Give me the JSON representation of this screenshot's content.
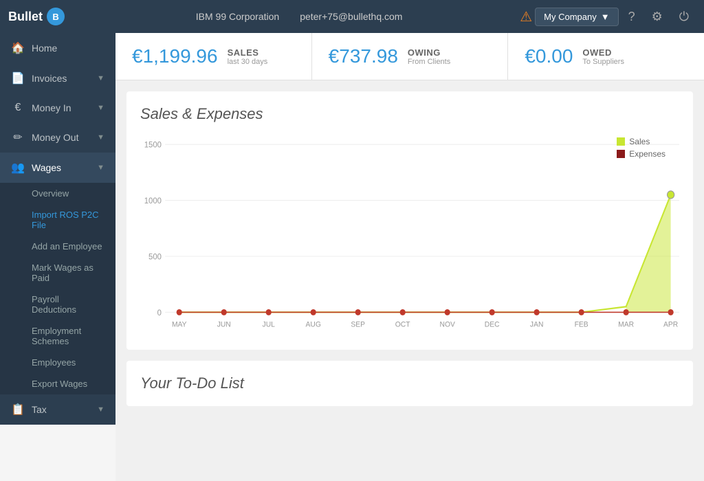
{
  "topnav": {
    "logo_text": "Bullet",
    "logo_badge": "B",
    "company": "IBM 99 Corporation",
    "email": "peter+75@bullethq.com",
    "company_btn": "My Company",
    "warning_symbol": "⚠",
    "help_symbol": "?",
    "gear_symbol": "⚙",
    "power_symbol": "⏻"
  },
  "sidebar": {
    "items": [
      {
        "id": "home",
        "label": "Home",
        "icon": "🏠"
      },
      {
        "id": "invoices",
        "label": "Invoices",
        "icon": "📄",
        "has_arrow": true
      },
      {
        "id": "money-in",
        "label": "Money In",
        "icon": "€",
        "has_arrow": true
      },
      {
        "id": "money-out",
        "label": "Money Out",
        "icon": "✏",
        "has_arrow": true
      },
      {
        "id": "wages",
        "label": "Wages",
        "icon": "👥",
        "has_arrow": true,
        "active": true
      }
    ],
    "wages_submenu": [
      {
        "id": "overview",
        "label": "Overview"
      },
      {
        "id": "import-ros",
        "label": "Import ROS P2C File",
        "active": true
      },
      {
        "id": "add-employee",
        "label": "Add an Employee"
      },
      {
        "id": "mark-wages-paid",
        "label": "Mark Wages as Paid"
      },
      {
        "id": "payroll-deductions",
        "label": "Payroll Deductions"
      },
      {
        "id": "employment-schemes",
        "label": "Employment Schemes"
      },
      {
        "id": "employees",
        "label": "Employees"
      },
      {
        "id": "export-wages",
        "label": "Export Wages"
      }
    ],
    "bottom_items": [
      {
        "id": "tax",
        "label": "Tax",
        "icon": "📋",
        "has_arrow": true
      }
    ]
  },
  "stats": [
    {
      "id": "sales",
      "value": "€1,199.96",
      "label": "SALES",
      "sublabel": "last 30 days"
    },
    {
      "id": "owing",
      "value": "€737.98",
      "label": "OWING",
      "sublabel": "From Clients"
    },
    {
      "id": "owed",
      "value": "€0.00",
      "label": "OWED",
      "sublabel": "To Suppliers"
    }
  ],
  "chart": {
    "title": "Sales & Expenses",
    "legend": [
      {
        "id": "sales",
        "label": "Sales",
        "color": "#c8e632"
      },
      {
        "id": "expenses",
        "label": "Expenses",
        "color": "#8b1a1a"
      }
    ],
    "months": [
      "MAY",
      "JUN",
      "JUL",
      "AUG",
      "SEP",
      "OCT",
      "NOV",
      "DEC",
      "JAN",
      "FEB",
      "MAR",
      "APR"
    ],
    "y_labels": [
      "1500",
      "1000",
      "500",
      "0"
    ],
    "sales_data": [
      0,
      0,
      0,
      0,
      0,
      0,
      0,
      0,
      0,
      0,
      50,
      1050
    ],
    "expenses_data": [
      0,
      0,
      0,
      0,
      0,
      0,
      0,
      0,
      0,
      0,
      0,
      0
    ]
  },
  "todo": {
    "title": "Your To-Do List"
  }
}
